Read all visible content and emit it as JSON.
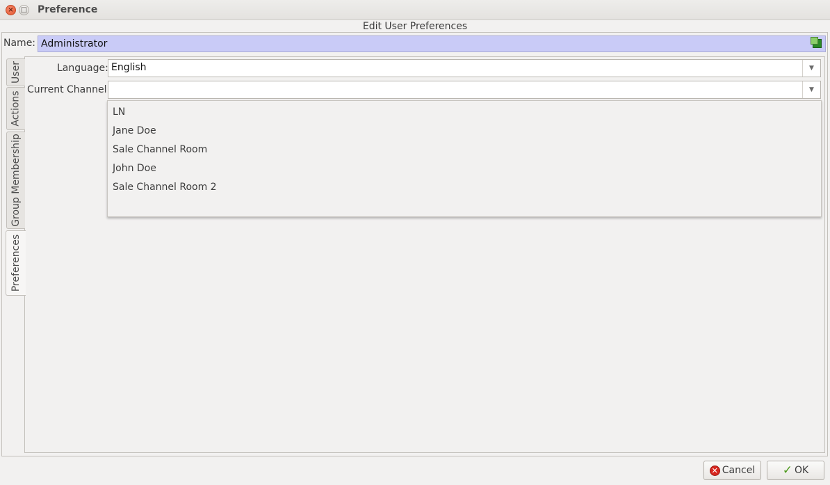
{
  "window": {
    "title": "Preference",
    "close_glyph": "×",
    "maximize_glyph": "□"
  },
  "dialog": {
    "header": "Edit User Preferences",
    "name_label": "Name:",
    "name_value": "Administrator",
    "name_icon": "entity-icon"
  },
  "tabs": [
    {
      "label": "User",
      "active": false
    },
    {
      "label": "Actions",
      "active": false
    },
    {
      "label": "Group Membership",
      "active": false
    },
    {
      "label": "Preferences",
      "active": true
    }
  ],
  "form": {
    "language_label": "Language:",
    "language_value": "English",
    "channel_label": "Current Channel:",
    "channel_value": ""
  },
  "channel_options": [
    "LN",
    "Jane Doe",
    "Sale Channel Room",
    "John Doe",
    "Sale Channel Room 2"
  ],
  "buttons": {
    "cancel_label": "Cancel",
    "ok_label": "OK"
  },
  "colors": {
    "name_field_bg": "#c9cbf7",
    "cancel_icon": "#d8261f",
    "ok_icon": "#4c9a1c"
  }
}
